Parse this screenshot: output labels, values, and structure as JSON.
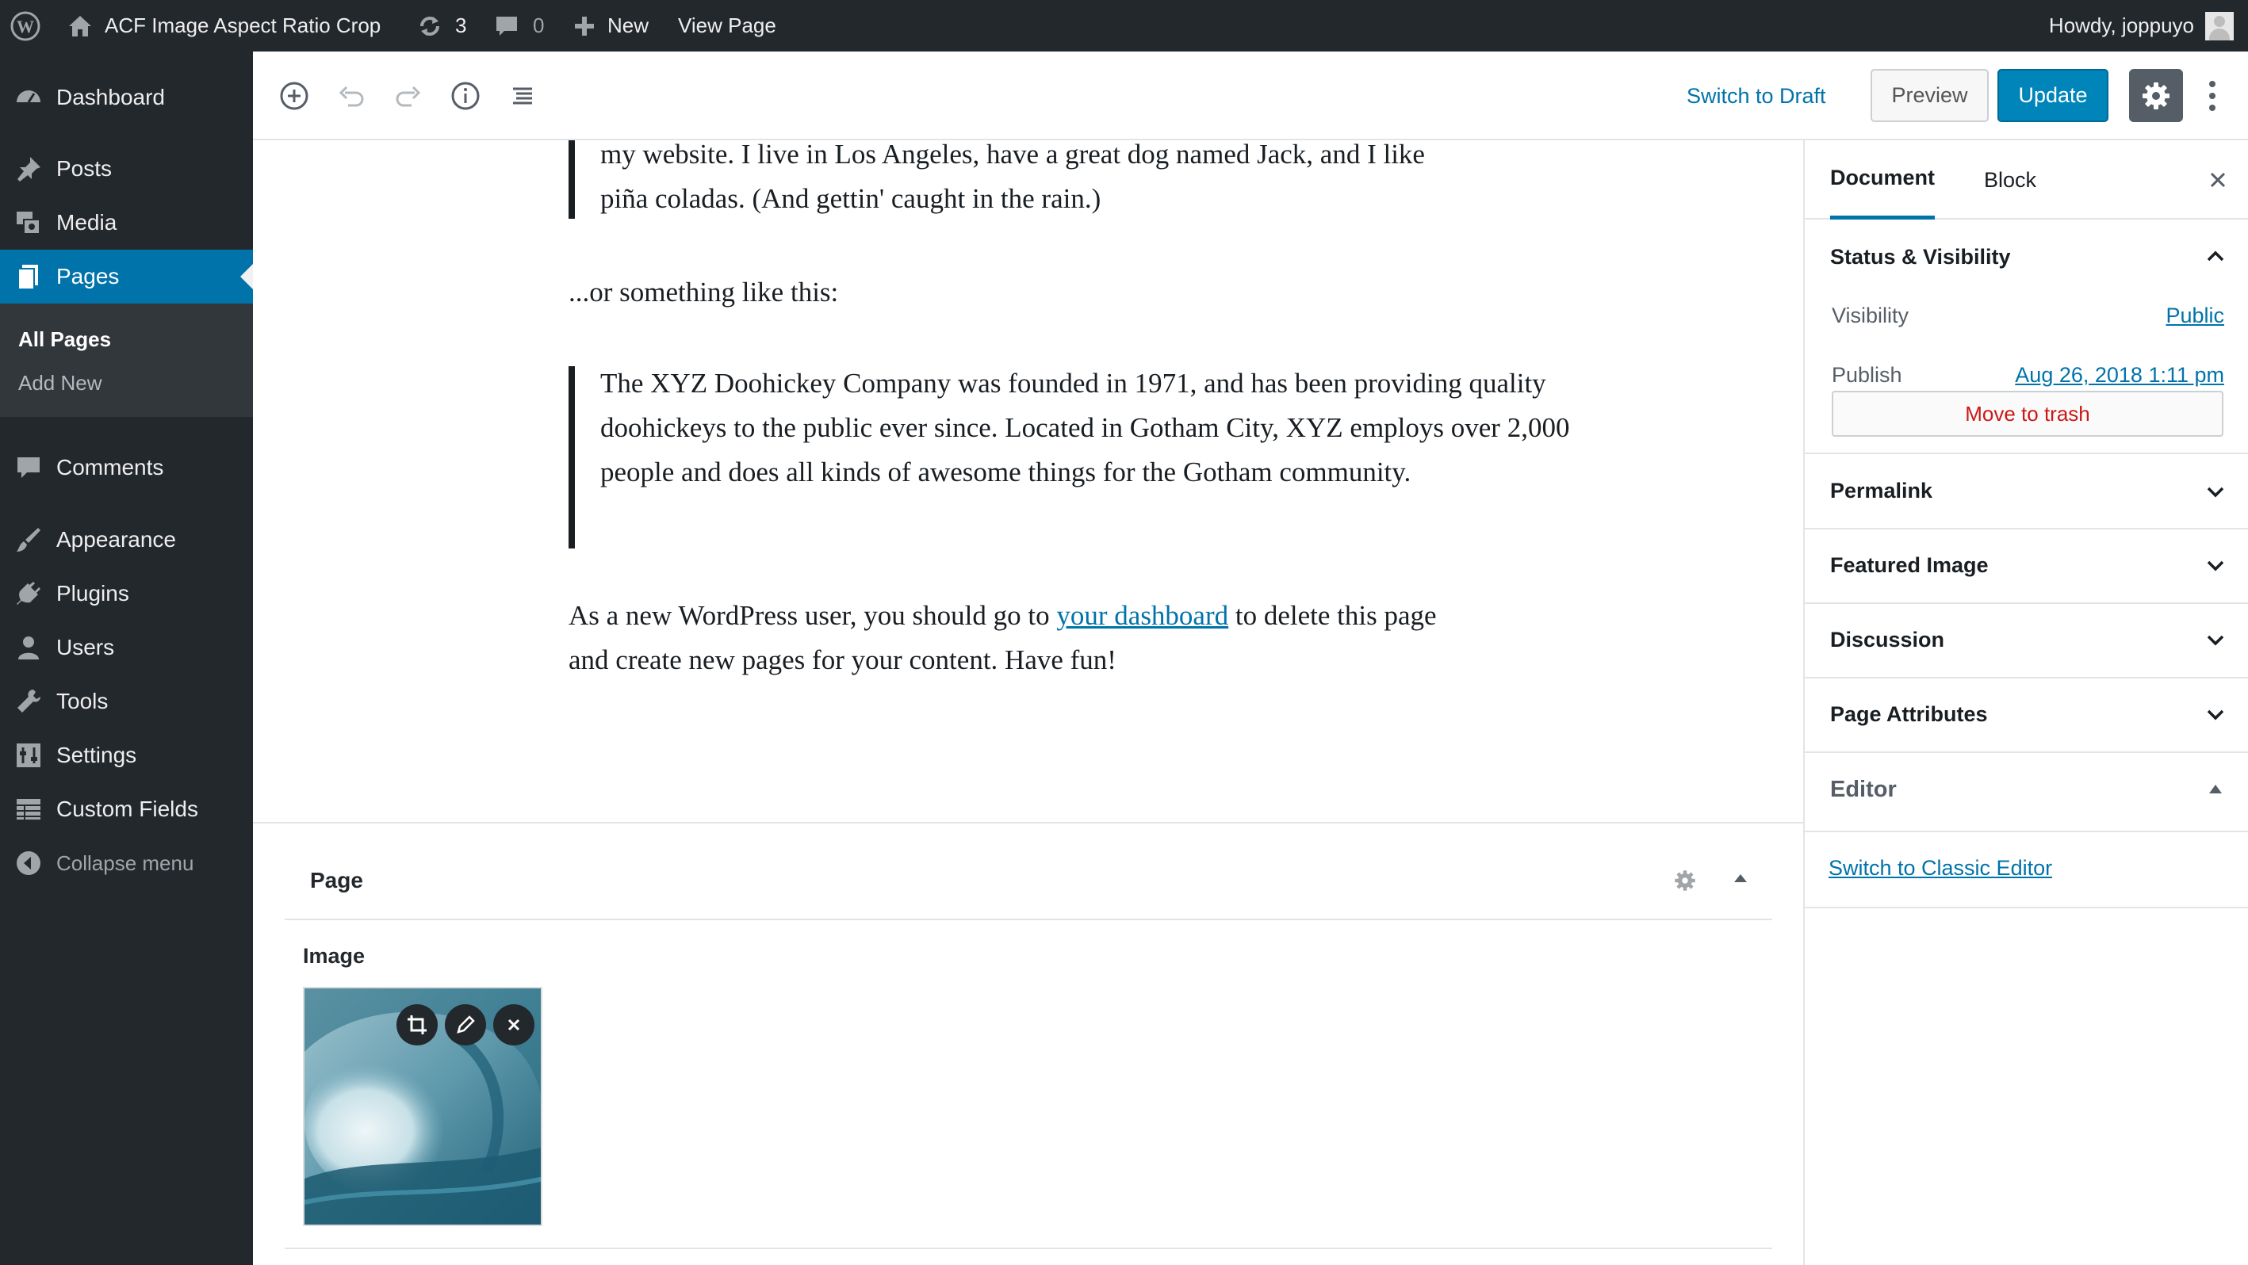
{
  "adminbar": {
    "site_title": "ACF Image Aspect Ratio Crop",
    "updates_count": "3",
    "comments_count": "0",
    "new_label": "New",
    "view_page_label": "View Page",
    "howdy": "Howdy, joppuyo"
  },
  "sidebar": {
    "dashboard": "Dashboard",
    "posts": "Posts",
    "media": "Media",
    "pages": "Pages",
    "all_pages": "All Pages",
    "add_new": "Add New",
    "comments": "Comments",
    "appearance": "Appearance",
    "plugins": "Plugins",
    "users": "Users",
    "tools": "Tools",
    "settings": "Settings",
    "custom_fields": "Custom Fields",
    "collapse": "Collapse menu"
  },
  "toolbar": {
    "switch_to_draft": "Switch to Draft",
    "preview": "Preview",
    "update": "Update"
  },
  "content": {
    "quote1_line1": "my website. I live in Los Angeles, have a great dog named Jack, and I like",
    "quote1_line2": "piña coladas. (And gettin' caught in the rain.)",
    "para1": "...or something like this:",
    "quote2": "The XYZ Doohickey Company was founded in 1971, and has been providing quality doohickeys to the public ever since. Located in Gotham City, XYZ employs over 2,000 people and does all kinds of awesome things for the Gotham community.",
    "para2_before": "As a new WordPress user, you should go to ",
    "para2_link": "your dashboard",
    "para2_after": " to delete this page and create new pages for your content. Have fun!"
  },
  "metabox": {
    "title": "Page",
    "image_label": "Image"
  },
  "settings_panel": {
    "tab_document": "Document",
    "tab_block": "Block",
    "status_visibility": "Status & Visibility",
    "visibility_label": "Visibility",
    "visibility_value": "Public",
    "publish_label": "Publish",
    "publish_value": "Aug 26, 2018 1:11 pm",
    "move_to_trash": "Move to trash",
    "permalink": "Permalink",
    "featured_image": "Featured Image",
    "discussion": "Discussion",
    "page_attributes": "Page Attributes",
    "editor": "Editor",
    "switch_classic": "Switch to Classic Editor"
  },
  "colors": {
    "admin_dark": "#23282d",
    "accent": "#0073aa",
    "update_button": "#0085ba",
    "trash_red": "#cc1818"
  }
}
